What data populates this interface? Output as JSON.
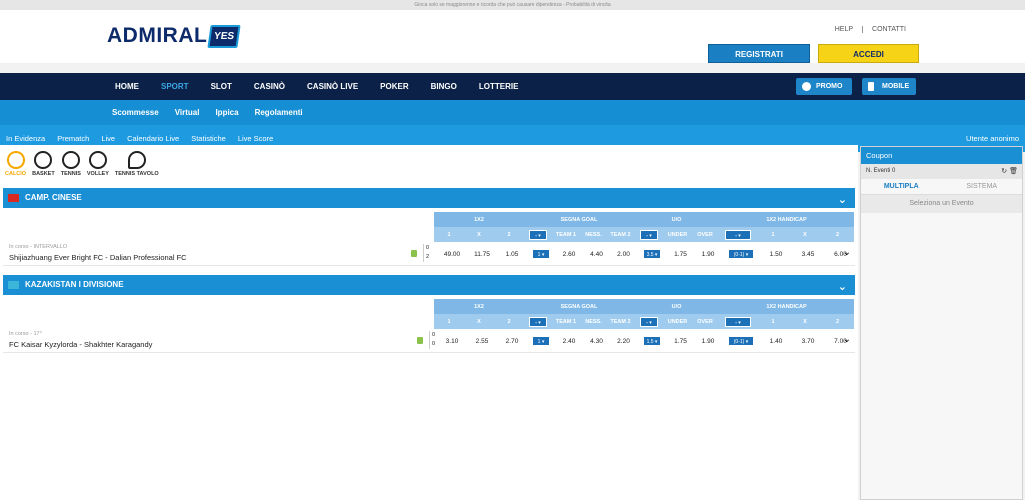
{
  "warning": "Gioca solo se maggiorenne e ricorda che può causare dipendenza - Probabilità di vincita",
  "logo": {
    "text": "ADMIRAL",
    "badge": "YES"
  },
  "toplinks": [
    "HELP",
    "CONTATTI"
  ],
  "auth": {
    "register": "REGISTRATI",
    "login": "ACCEDI"
  },
  "mainnav": {
    "items": [
      "HOME",
      "SPORT",
      "SLOT",
      "CASINÒ",
      "CASINÒ LIVE",
      "POKER",
      "BINGO",
      "LOTTERIE"
    ],
    "active": "SPORT",
    "promo": "PROMO",
    "mobile": "MOBILE"
  },
  "subnav": [
    "Scommesse",
    "Virtual",
    "Ippica",
    "Regolamenti"
  ],
  "subnav2": [
    "In Evidenza",
    "Prematch",
    "Live",
    "Calendario Live",
    "Statistiche",
    "Live Score"
  ],
  "user": "Utente anonimo",
  "sports": [
    "CALCIO",
    "BASKET",
    "TENNIS",
    "VOLLEY",
    "TENNIS TAVOLO"
  ],
  "odds_header": {
    "groups": [
      "1X2",
      "SEGNA GOAL",
      "U/O",
      "1X2 HANDICAP"
    ],
    "cols": [
      "1",
      "X",
      "2",
      "-",
      "TEAM 1",
      "NESS.",
      "TEAM 2",
      "-",
      "UNDER",
      "OVER",
      "-",
      "1",
      "X",
      "2"
    ]
  },
  "leagues": [
    {
      "name": "CAMP. CINESE",
      "match": {
        "status": "In corso - INTERVALLO",
        "name": "Shijiazhuang Ever Bright FC - Dalian Professional FC",
        "score": [
          "0",
          "2"
        ],
        "odds": [
          "49.00",
          "11.75",
          "1.05",
          "1",
          "2.60",
          "4.40",
          "2.00",
          "3.5",
          "1.75",
          "1.90",
          "(0-1)",
          "1.50",
          "3.45",
          "6.00"
        ]
      }
    },
    {
      "name": "KAZAKISTAN I DIVISIONE",
      "match": {
        "status": "In corso - 17°",
        "name": "FC Kaisar Kyzylorda - Shakhter Karagandy",
        "score": [
          "0",
          "0"
        ],
        "odds": [
          "3.10",
          "2.55",
          "2.70",
          "1",
          "2.40",
          "4.30",
          "2.20",
          "1.5",
          "1.75",
          "1.90",
          "(0-1)",
          "1.40",
          "3.70",
          "7.00"
        ]
      }
    }
  ],
  "coupon": {
    "title": "Coupon",
    "events": "N. Eventi 0",
    "tabs": [
      "MULTIPLA",
      "SISTEMA"
    ],
    "empty": "Seleziona un Evento"
  }
}
